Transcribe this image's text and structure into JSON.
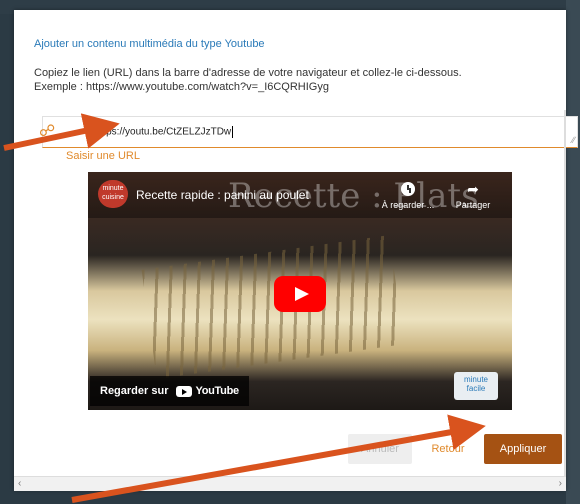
{
  "dialog": {
    "title": "Ajouter un contenu multimédia du type Youtube",
    "instruction_line1": "Copiez le lien (URL) dans la barre d'adresse de votre navigateur et collez-le ci-dessous.",
    "instruction_line2": "Exemple : https://www.youtube.com/watch?v=_I6CQRHIGyg",
    "url_value": "https://youtu.be/CtZELZJzTDw",
    "url_hint": "Saisir une URL"
  },
  "video": {
    "background_title": "Recette : Plats",
    "channel_logo_text": "minute cuisine",
    "title": "Recette rapide : panini au poulet",
    "watch_later_label": "À regarder ...",
    "share_label": "Partager",
    "watch_on_label": "Regarder sur",
    "youtube_wordmark": "YouTube",
    "corner_badge": "minute facile"
  },
  "buttons": {
    "cancel_label": "Annuler",
    "back_label": "Retour",
    "apply_label": "Appliquer"
  },
  "colors": {
    "accent": "#e08a2c",
    "apply_button": "#a55213",
    "title_blue": "#2a7ab8",
    "arrow": "#d9531e"
  }
}
